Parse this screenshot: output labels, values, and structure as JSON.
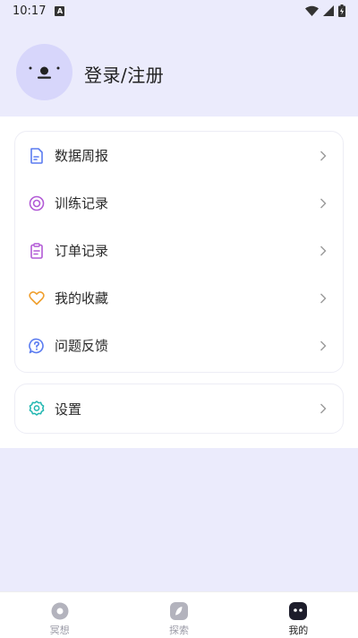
{
  "status_bar": {
    "time": "10:17",
    "notification_icon": "A"
  },
  "header": {
    "title": "登录/注册",
    "avatar": "avatar-face-icon"
  },
  "menu": {
    "items": [
      {
        "label": "数据周报",
        "icon": "document-icon",
        "color": "#5b7cf0"
      },
      {
        "label": "训练记录",
        "icon": "target-icon",
        "color": "#b25ad6"
      },
      {
        "label": "订单记录",
        "icon": "clipboard-icon",
        "color": "#b25ad6"
      },
      {
        "label": "我的收藏",
        "icon": "heart-icon",
        "color": "#f0a030"
      },
      {
        "label": "问题反馈",
        "icon": "help-chat-icon",
        "color": "#5b7cf0"
      }
    ]
  },
  "settings": {
    "label": "设置",
    "icon": "gear-icon",
    "color": "#1fb6b0"
  },
  "tabs": [
    {
      "label": "冥想",
      "icon": "meditate-icon",
      "active": false
    },
    {
      "label": "探索",
      "icon": "compass-icon",
      "active": false
    },
    {
      "label": "我的",
      "icon": "profile-icon",
      "active": true
    }
  ],
  "colors": {
    "background": "#ebebfc",
    "avatar": "#d7d6fb",
    "card_border": "#ededf5"
  }
}
